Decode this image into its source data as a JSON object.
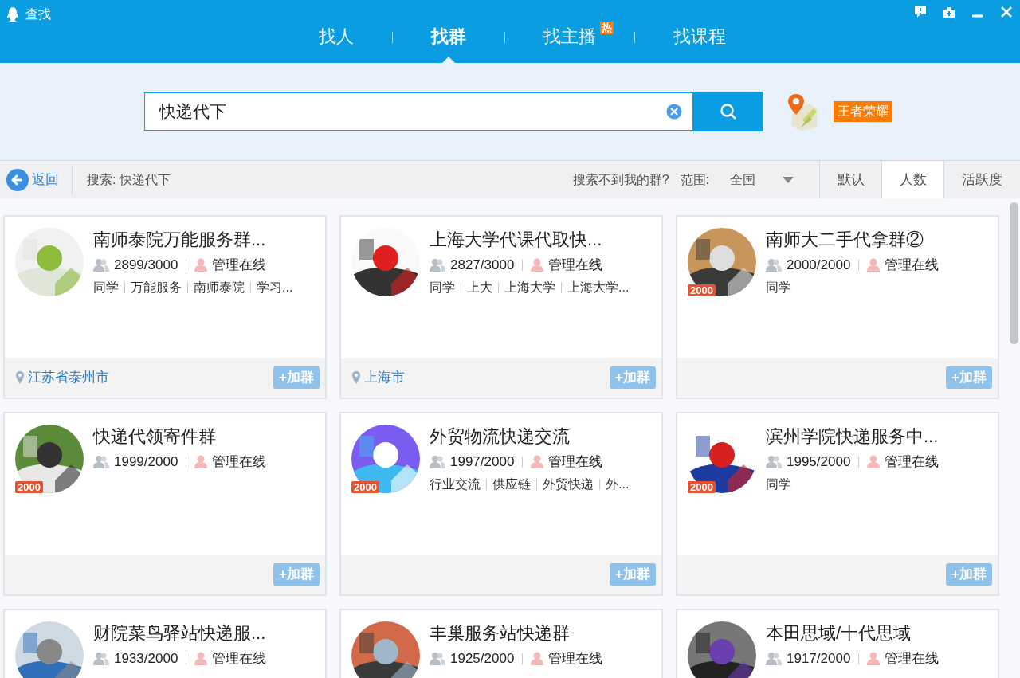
{
  "window": {
    "title": "查找"
  },
  "tabs": [
    {
      "label": "找人",
      "selected": false
    },
    {
      "label": "找群",
      "selected": true
    },
    {
      "label": "找主播",
      "selected": false,
      "badge": "热"
    },
    {
      "label": "找课程",
      "selected": false
    }
  ],
  "search": {
    "value": "快递代下"
  },
  "location_tag": "王者荣耀",
  "toolbar": {
    "back": "返回",
    "query": "搜索: 快递代下",
    "hint": "搜索不到我的群?",
    "range_label": "范围:",
    "range_value": "全国",
    "sort": [
      {
        "label": "默认",
        "selected": false
      },
      {
        "label": "人数",
        "selected": true
      },
      {
        "label": "活跃度",
        "selected": false
      }
    ]
  },
  "groups": [
    {
      "name": "南师泰院万能服务群...",
      "members": "2899/3000",
      "admin": "管理在线",
      "tags": [
        "同学",
        "万能服务",
        "南师泰院",
        "学习..."
      ],
      "location": "江苏省泰州市",
      "join": "+加群"
    },
    {
      "name": "上海大学代课代取快...",
      "members": "2827/3000",
      "admin": "管理在线",
      "tags": [
        "同学",
        "上大",
        "上海大学",
        "上海大学..."
      ],
      "location": "上海市",
      "join": "+加群"
    },
    {
      "name": "南师大二手代拿群②",
      "members": "2000/2000",
      "admin": "管理在线",
      "tags": [
        "同学"
      ],
      "badge": "2000",
      "join": "+加群"
    },
    {
      "name": "快递代领寄件群",
      "members": "1999/2000",
      "admin": "管理在线",
      "badge": "2000",
      "join": "+加群"
    },
    {
      "name": "外贸物流快递交流",
      "members": "1997/2000",
      "admin": "管理在线",
      "tags": [
        "行业交流",
        "供应链",
        "外贸快递",
        "外..."
      ],
      "badge": "2000",
      "join": "+加群"
    },
    {
      "name": "滨州学院快递服务中...",
      "members": "1995/2000",
      "admin": "管理在线",
      "tags": [
        "同学"
      ],
      "badge": "2000",
      "join": "+加群"
    },
    {
      "name": "财院菜鸟驿站快递服...",
      "members": "1933/2000",
      "admin": "管理在线"
    },
    {
      "name": "丰巢服务站快递群",
      "members": "1925/2000",
      "admin": "管理在线"
    },
    {
      "name": "本田思域/十代思域",
      "members": "1917/2000",
      "admin": "管理在线"
    }
  ]
}
